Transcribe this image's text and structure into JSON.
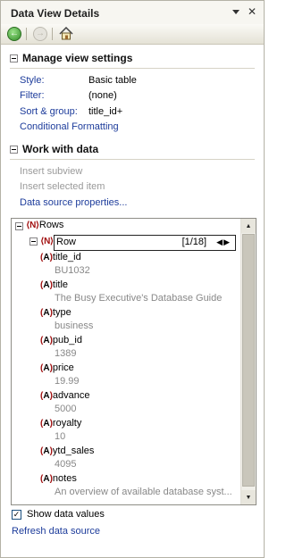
{
  "title": "Data View Details",
  "toolbar": {
    "back_icon": "back-arrow-icon",
    "forward_icon": "forward-arrow-icon",
    "home_icon": "home-icon"
  },
  "manage": {
    "heading": "Manage view settings",
    "style_label": "Style:",
    "style_value": "Basic table",
    "filter_label": "Filter:",
    "filter_value": "(none)",
    "sort_label": "Sort & group:",
    "sort_value": "title_id+",
    "conditional": "Conditional Formatting"
  },
  "work": {
    "heading": "Work with data",
    "insert_subview": "Insert subview",
    "insert_selected": "Insert selected item",
    "data_source_props": "Data source properties..."
  },
  "tree": {
    "rows_label": "Rows",
    "row_label": "Row",
    "pager": "[1/18]",
    "fields": [
      {
        "name": "title_id",
        "value": "BU1032"
      },
      {
        "name": "title",
        "value": "The Busy Executive's Database Guide"
      },
      {
        "name": "type",
        "value": "business"
      },
      {
        "name": "pub_id",
        "value": "1389"
      },
      {
        "name": "price",
        "value": "19.99"
      },
      {
        "name": "advance",
        "value": "5000"
      },
      {
        "name": "royalty",
        "value": "10"
      },
      {
        "name": "ytd_sales",
        "value": "4095"
      },
      {
        "name": "notes",
        "value": "An overview of available database syst..."
      }
    ]
  },
  "show_data_values": "Show data values",
  "refresh": "Refresh data source"
}
